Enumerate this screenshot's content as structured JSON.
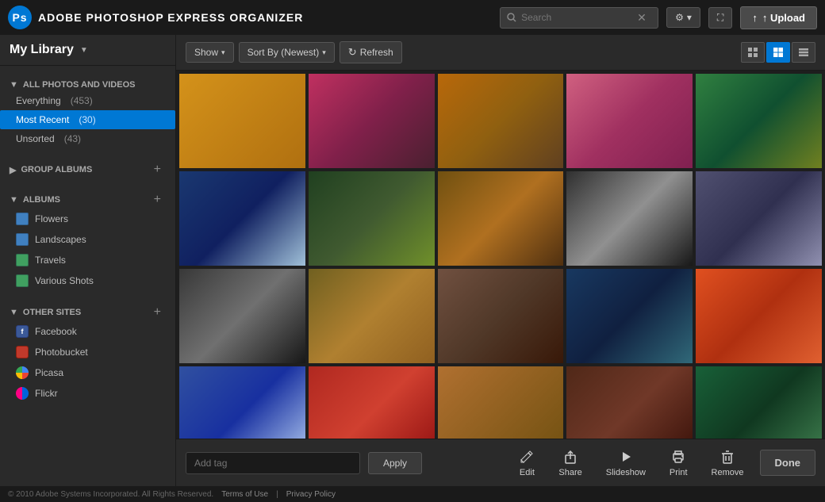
{
  "app": {
    "title": "ADOBE PHOTOSHOP EXPRESS ORGANIZER",
    "logo_letter": "Ps"
  },
  "header": {
    "search_placeholder": "Search",
    "gear_label": "⚙",
    "fullscreen_label": "⛶",
    "upload_label": "↑ Upload"
  },
  "my_library": {
    "label": "My Library",
    "arrow": "▼"
  },
  "all_photos": {
    "title": "ALL PHOTOS AND VIDEOS",
    "items": [
      {
        "label": "Everything",
        "count": "(453)"
      },
      {
        "label": "Most Recent",
        "count": "(30)",
        "active": true
      },
      {
        "label": "Unsorted",
        "count": "(43)"
      }
    ]
  },
  "group_albums": {
    "title": "GROUP ALBUMS"
  },
  "albums": {
    "title": "ALBUMS",
    "items": [
      {
        "label": "Flowers",
        "color": "#4080c0"
      },
      {
        "label": "Landscapes",
        "color": "#4080c0"
      },
      {
        "label": "Travels",
        "color": "#40a060"
      },
      {
        "label": "Various Shots",
        "color": "#40a060"
      }
    ]
  },
  "other_sites": {
    "title": "OTHER SITES",
    "items": [
      {
        "label": "Facebook",
        "color": "#3b5998"
      },
      {
        "label": "Photobucket",
        "color": "#c0392b"
      },
      {
        "label": "Picasa",
        "color": "#4285f4"
      },
      {
        "label": "Flickr",
        "color": "#ff0084"
      }
    ]
  },
  "toolbar": {
    "show_label": "Show",
    "sort_label": "Sort By (Newest)",
    "refresh_label": "Refresh",
    "view_grid_sm": "⊞",
    "view_grid_lg": "⊟",
    "view_list": "≡"
  },
  "photos": [
    {
      "id": 1,
      "cls": "p1"
    },
    {
      "id": 2,
      "cls": "p2"
    },
    {
      "id": 3,
      "cls": "p3"
    },
    {
      "id": 4,
      "cls": "p4"
    },
    {
      "id": 5,
      "cls": "p5"
    },
    {
      "id": 6,
      "cls": "p6"
    },
    {
      "id": 7,
      "cls": "p7"
    },
    {
      "id": 8,
      "cls": "p8"
    },
    {
      "id": 9,
      "cls": "p9"
    },
    {
      "id": 10,
      "cls": "p10"
    },
    {
      "id": 11,
      "cls": "p11"
    },
    {
      "id": 12,
      "cls": "p12"
    },
    {
      "id": 13,
      "cls": "p13"
    },
    {
      "id": 14,
      "cls": "p14"
    },
    {
      "id": 15,
      "cls": "p15"
    },
    {
      "id": 16,
      "cls": "p16"
    },
    {
      "id": 17,
      "cls": "p17"
    },
    {
      "id": 18,
      "cls": "p18"
    },
    {
      "id": 19,
      "cls": "p19"
    },
    {
      "id": 20,
      "cls": "p20"
    }
  ],
  "bottom": {
    "tag_placeholder": "Add tag",
    "apply_label": "Apply",
    "actions": [
      {
        "key": "edit",
        "icon": "✏",
        "label": "Edit"
      },
      {
        "key": "share",
        "icon": "↑",
        "label": "Share"
      },
      {
        "key": "slideshow",
        "icon": "▶",
        "label": "Slideshow"
      },
      {
        "key": "print",
        "icon": "🖨",
        "label": "Print"
      },
      {
        "key": "remove",
        "icon": "🗑",
        "label": "Remove"
      }
    ],
    "done_label": "Done"
  },
  "footer": {
    "copyright": "© 2010 Adobe Systems Incorporated. All Rights Reserved.",
    "terms": "Terms of Use",
    "privacy": "Privacy Policy"
  }
}
